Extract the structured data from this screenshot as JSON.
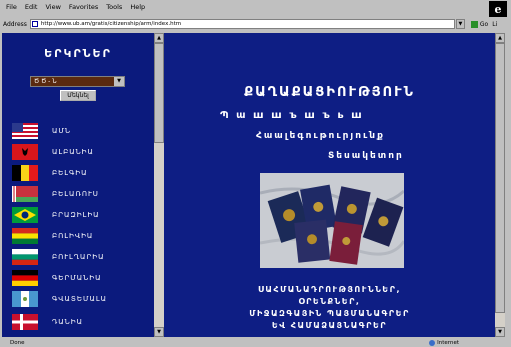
{
  "menu": [
    "File",
    "Edit",
    "View",
    "Favorites",
    "Tools",
    "Help"
  ],
  "address": {
    "label": "Address",
    "url": "http://www.ub.am/gratis/citizenship/arm/index.htm",
    "go_label": "Go",
    "go_extra": "Li"
  },
  "left": {
    "title": "ԵՐԿՐՆԵՐ",
    "select_value": "Ծ Ծ - Ն",
    "go_button": "Մեկնել",
    "languages": [
      {
        "label": "ԱՄՆ",
        "flag": "usa"
      },
      {
        "label": "ԱԼԲԱՆԻԱ",
        "flag": "albania"
      },
      {
        "label": "ԲԵԼԳԻԱ",
        "flag": "belgium"
      },
      {
        "label": "ԲԵԼԱՌՈՒՍ",
        "flag": "belarus"
      },
      {
        "label": "ԲՐԱԶԻԼԻԱ",
        "flag": "brazil"
      },
      {
        "label": "ԲՈԼԻՎԻԱ",
        "flag": "bolivia"
      },
      {
        "label": "ԲՈՒԼՂԱՐԻԱ",
        "flag": "bulgaria"
      },
      {
        "label": "ԳԵՐՄԱՆԻԱ",
        "flag": "germany"
      },
      {
        "label": "ԳՎԱՏԵՄԱԼԱ",
        "flag": "guatemala"
      },
      {
        "label": "ԴԱՆԻԱ",
        "flag": "denmark"
      }
    ]
  },
  "right": {
    "title": "ՔԱՂԱՔԱՑԻՈՒԹՅՈՒՆ",
    "line1": "Պ ա ш ш ъ ш ъ ь ш",
    "line2": "Հաալեգութուրյունք",
    "line3": "Տեսակետոր",
    "bottom1": "ՍԱՀՄԱՆԱԴՐՈՒԹՅՈՒՆՆԵՐ,",
    "bottom2": "ՕՐԵՆՔՆԵՐ,",
    "bottom3": "ՄԻՋԱԶԳԱՅԻՆ ՊԱՅՄԱՆԱԳՐԵՐ",
    "bottom4": "ԵՎ ՀԱՄԱՁԱՅՆԱԳՐԵՐ"
  },
  "status": {
    "text": "Done",
    "zone": "Internet"
  },
  "colors": {
    "background": "#0d1d80",
    "chrome": "#c0c0c0"
  }
}
